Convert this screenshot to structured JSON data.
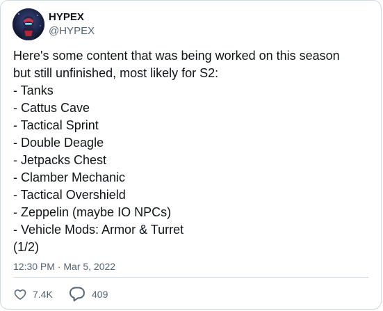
{
  "tweet": {
    "author_name": "HYPEX",
    "author_handle": "@HYPEX",
    "text": "Here's some content that was being worked on this season\nbut still unfinished, most likely for S2:\n- Tanks\n- Cattus Cave\n- Tactical Sprint\n- Double Deagle\n- Jetpacks Chest\n- Clamber Mechanic\n- Tactical Overshield\n- Zeppelin (maybe IO NPCs)\n- Vehicle Mods: Armor & Turret\n(1/2)",
    "timestamp": "12:30 PM · Mar 5, 2022",
    "like_count": "7.4K",
    "reply_count": "409"
  },
  "icons": {
    "like": "heart-icon",
    "reply": "reply-bubble-icon"
  },
  "colors": {
    "text": "#0f1419",
    "secondary": "#536471",
    "border": "#cfd9de"
  }
}
